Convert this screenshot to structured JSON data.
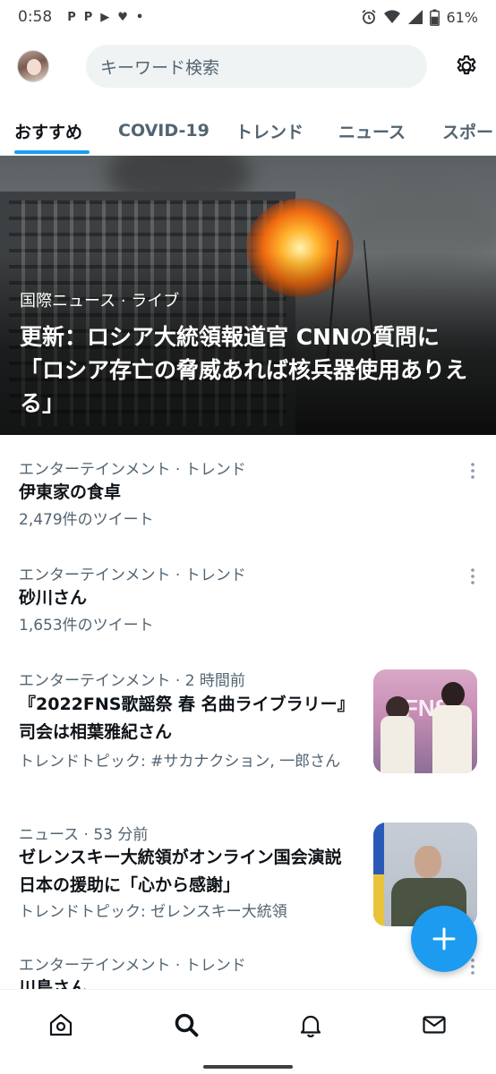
{
  "status_bar": {
    "time": "0:58",
    "notification_icons": [
      "p-app-icon",
      "p-app-icon",
      "youtube-icon",
      "heart-icon",
      "dot-icon"
    ],
    "notif_glyphs": [
      "P",
      "P",
      "▶",
      "♥",
      "•"
    ],
    "battery_percent": "61%",
    "battery_level": 0.61
  },
  "header": {
    "search_placeholder": "キーワード検索"
  },
  "tabs": [
    {
      "label": "おすすめ",
      "active": true
    },
    {
      "label": "COVID-19",
      "active": false
    },
    {
      "label": "トレンド",
      "active": false
    },
    {
      "label": "ニュース",
      "active": false
    },
    {
      "label": "スポー",
      "active": false
    }
  ],
  "hero": {
    "meta": "国際ニュース · ライブ",
    "title": "更新：ロシア大統領報道官 CNNの質問に「ロシア存亡の脅威あれば核兵器使用ありえる」"
  },
  "feed": [
    {
      "meta": "エンターテインメント · トレンド",
      "title": "伊東家の食卓",
      "sub": "2,479件のツイート",
      "has_thumb": false
    },
    {
      "meta": "エンターテインメント · トレンド",
      "title": "砂川さん",
      "sub": "1,653件のツイート",
      "has_thumb": false
    },
    {
      "meta": "エンターテインメント · 2 時間前",
      "title": "『2022FNS歌謡祭 春 名曲ライブラリー』司会は相葉雅紀さん",
      "sub": "トレンドトピック: #サカナクション, 一郎さん",
      "has_thumb": true,
      "thumb_text": "FNS"
    },
    {
      "meta": "ニュース · 53 分前",
      "title": "ゼレンスキー大統領がオンライン国会演説 日本の援助に「心から感謝」",
      "sub": "トレンドトピック: ゼレンスキー大統領",
      "has_thumb": true
    },
    {
      "meta": "エンターテインメント · トレンド",
      "title": "川島さん",
      "sub": "",
      "has_thumb": false
    }
  ],
  "bottom_nav": [
    {
      "name": "home",
      "icon": "home-icon",
      "active": false
    },
    {
      "name": "explore",
      "icon": "search-icon",
      "active": true
    },
    {
      "name": "notifications",
      "icon": "bell-icon",
      "active": false
    },
    {
      "name": "messages",
      "icon": "mail-icon",
      "active": false
    }
  ],
  "colors": {
    "accent": "#1d9bf0",
    "text_primary": "#0f1419",
    "text_secondary": "#536471"
  }
}
